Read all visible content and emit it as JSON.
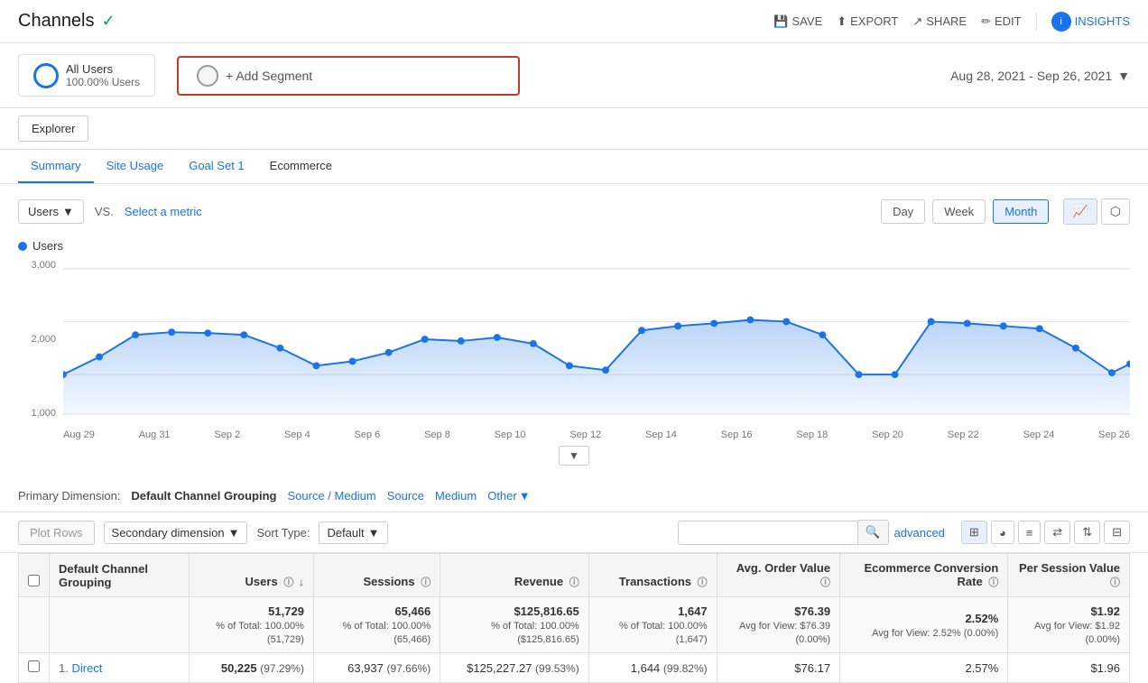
{
  "header": {
    "title": "Channels",
    "save_label": "SAVE",
    "export_label": "EXPORT",
    "share_label": "SHARE",
    "edit_label": "EDIT",
    "insights_label": "INSIGHTS"
  },
  "segments": {
    "all_users_label": "All Users",
    "all_users_pct": "100.00% Users",
    "add_segment_label": "+ Add Segment"
  },
  "date_range": {
    "label": "Aug 28, 2021 - Sep 26, 2021"
  },
  "tabs": {
    "explorer_label": "Explorer",
    "sub_tabs": [
      "Summary",
      "Site Usage",
      "Goal Set 1",
      "Ecommerce"
    ]
  },
  "chart": {
    "metric_label": "Users",
    "vs_label": "VS.",
    "select_metric_label": "Select a metric",
    "time_buttons": [
      "Day",
      "Week",
      "Month"
    ],
    "active_time": "Month",
    "legend_label": "Users",
    "y_labels": [
      "3,000",
      "2,000",
      "1,000"
    ],
    "x_labels": [
      "Aug 29",
      "Aug 31",
      "Sep 2",
      "Sep 4",
      "Sep 6",
      "Sep 8",
      "Sep 10",
      "Sep 12",
      "Sep 14",
      "Sep 16",
      "Sep 18",
      "Sep 20",
      "Sep 22",
      "Sep 24",
      "Sep 26"
    ]
  },
  "primary_dimension": {
    "label": "Primary Dimension:",
    "value": "Default Channel Grouping",
    "links": [
      "Source / Medium",
      "Source",
      "Medium",
      "Other"
    ]
  },
  "table_controls": {
    "plot_rows_label": "Plot Rows",
    "secondary_dim_label": "Secondary dimension",
    "sort_label": "Sort Type:",
    "sort_value": "Default",
    "search_placeholder": "",
    "advanced_label": "advanced"
  },
  "table": {
    "headers": [
      {
        "label": "Default Channel Grouping",
        "has_info": false,
        "numeric": false
      },
      {
        "label": "Users",
        "has_info": true,
        "numeric": true,
        "has_sort": true
      },
      {
        "label": "Sessions",
        "has_info": true,
        "numeric": true
      },
      {
        "label": "Revenue",
        "has_info": true,
        "numeric": true
      },
      {
        "label": "Transactions",
        "has_info": true,
        "numeric": true
      },
      {
        "label": "Avg. Order Value",
        "has_info": true,
        "numeric": true
      },
      {
        "label": "Ecommerce Conversion Rate",
        "has_info": true,
        "numeric": true
      },
      {
        "label": "Per Session Value",
        "has_info": true,
        "numeric": true
      }
    ],
    "totals": {
      "users": "51,729",
      "users_sub": "% of Total: 100.00% (51,729)",
      "sessions": "65,466",
      "sessions_sub": "% of Total: 100.00% (65,466)",
      "revenue": "$125,816.65",
      "revenue_sub": "% of Total: 100.00% ($125,816.65)",
      "transactions": "1,647",
      "transactions_sub": "% of Total: 100.00% (1,647)",
      "avg_order": "$76.39",
      "avg_order_sub": "Avg for View: $76.39 (0.00%)",
      "conversion": "2.52%",
      "conversion_sub": "Avg for View: 2.52% (0.00%)",
      "per_session": "$1.92",
      "per_session_sub": "Avg for View: $1.92 (0.00%)"
    },
    "rows": [
      {
        "num": "1.",
        "channel": "Direct",
        "users": "50,225",
        "users_pct": "97.29%",
        "sessions": "63,937",
        "sessions_pct": "97.66%",
        "revenue": "$125,227.27",
        "revenue_pct": "99.53%",
        "transactions": "1,644",
        "transactions_pct": "99.82%",
        "avg_order": "$76.17",
        "conversion": "2.57%",
        "per_session": "$1.96"
      }
    ]
  }
}
